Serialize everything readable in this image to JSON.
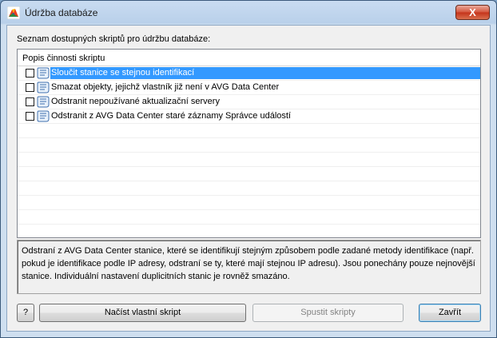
{
  "window": {
    "title": "Údržba databáze",
    "close_label": "X"
  },
  "main": {
    "caption": "Seznam dostupných skriptů pro údržbu databáze:",
    "list_header": "Popis činnosti skriptu",
    "scripts": [
      {
        "label": "Sloučit stanice se stejnou identifikací",
        "checked": false,
        "selected": true
      },
      {
        "label": "Smazat objekty, jejichž vlastník již není v AVG Data Center",
        "checked": false,
        "selected": false
      },
      {
        "label": "Odstranit nepoužívané aktualizační servery",
        "checked": false,
        "selected": false
      },
      {
        "label": "Odstranit z AVG Data Center staré záznamy Správce událostí",
        "checked": false,
        "selected": false
      }
    ],
    "description": "Odstraní z AVG Data Center stanice, které se identifikují stejným způsobem podle zadané metody identifikace (např. pokud je identifikace podle IP adresy, odstraní se ty, které mají stejnou IP adresu). Jsou ponechány pouze nejnovější stanice. Individuální nastavení duplicitních stanic je rovněž smazáno."
  },
  "buttons": {
    "help": "?",
    "load": "Načíst vlastní skript",
    "run": "Spustit skripty",
    "close": "Zavřít"
  },
  "icons": {
    "app": "avg-logo-icon",
    "script": "script-icon"
  },
  "colors": {
    "selection": "#3399ff",
    "close_button": "#c4321a"
  }
}
